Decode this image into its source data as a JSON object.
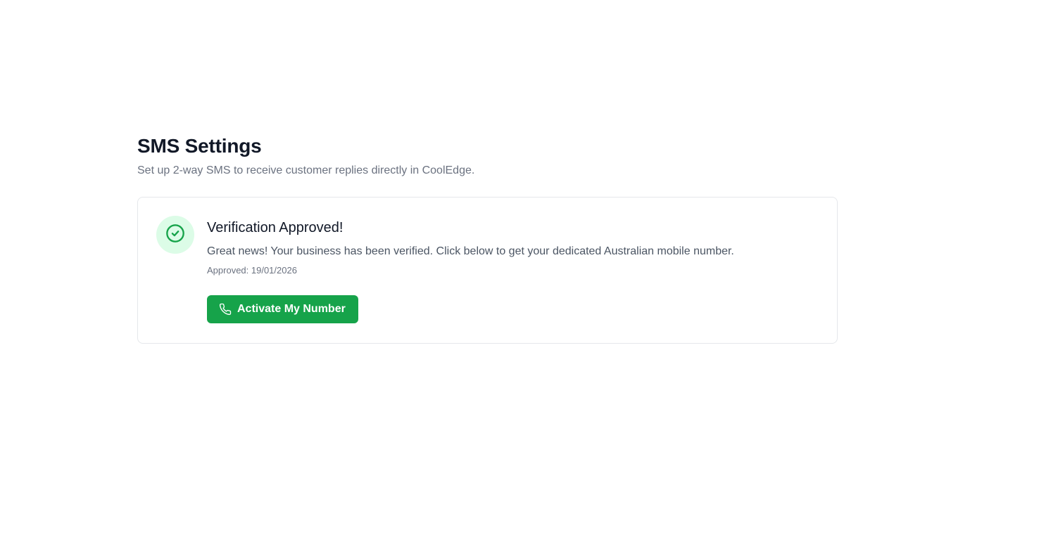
{
  "header": {
    "title": "SMS Settings",
    "subtitle": "Set up 2-way SMS to receive customer replies directly in CoolEdge."
  },
  "verification": {
    "status_icon": "check-circle-icon",
    "title": "Verification Approved!",
    "message": "Great news! Your business has been verified. Click below to get your dedicated Australian mobile number.",
    "approved_label": "Approved: 19/01/2026",
    "button": {
      "label": "Activate My Number",
      "icon": "phone-icon"
    }
  },
  "colors": {
    "accent": "#16a34a",
    "icon_bg": "#dcfce7",
    "title": "#111827",
    "muted": "#6b7280",
    "border": "#e5e7eb"
  }
}
